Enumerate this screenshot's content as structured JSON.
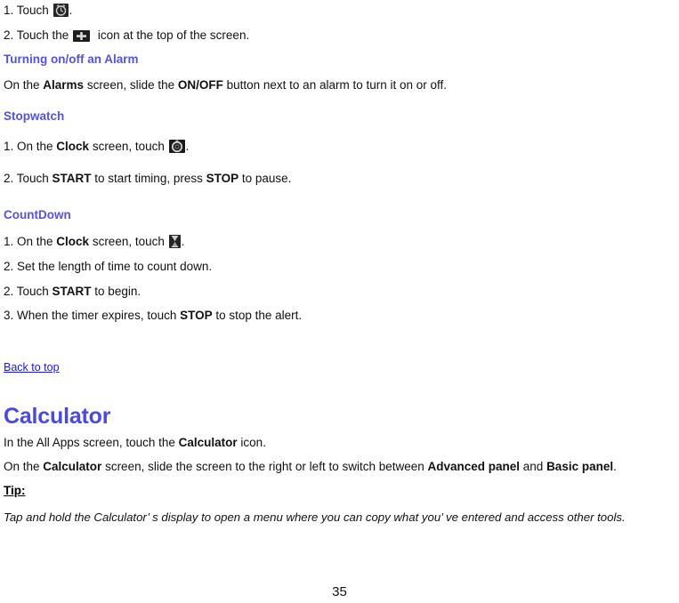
{
  "document": {
    "page_number": "35",
    "colors": {
      "heading_blue": "#5353e0",
      "main_heading_blue": "#4a4ae0",
      "link_blue": "#1a1ae0",
      "body_text": "#111111",
      "background": "#ffffff"
    }
  },
  "clock_section": {
    "step1": {
      "prefix": "1. Touch",
      "icon": "alarm-clock-icon",
      "suffix": "."
    },
    "step2": {
      "prefix": "2. Touch the",
      "icon": "add-plus-icon",
      "suffix": "icon at the top of the screen."
    }
  },
  "alarm_section": {
    "heading": "Turning on/off an Alarm",
    "body": {
      "part1": "On the ",
      "bold1": "Alarms",
      "part2": " screen, slide the ",
      "bold2": "ON/OFF",
      "part3": " button next to an alarm to turn it on or off."
    }
  },
  "stopwatch_section": {
    "heading": "Stopwatch",
    "step1": {
      "part1": "1. On the ",
      "bold1": "Clock",
      "part2": " screen, touch ",
      "icon": "stopwatch-icon",
      "suffix": "."
    },
    "step2": {
      "part1": "2. Touch ",
      "bold1": "START",
      "part2": " to start timing, press ",
      "bold2": "STOP",
      "part3": " to pause."
    }
  },
  "countdown_section": {
    "heading": "CountDown",
    "step1": {
      "part1": "1. On the ",
      "bold1": "Clock",
      "part2": " screen, touch ",
      "icon": "hourglass-icon",
      "suffix": "."
    },
    "step2": "2. Set the length of time to count down.",
    "step3": {
      "part1": "2. Touch ",
      "bold1": "START",
      "part2": " to begin."
    },
    "step4": {
      "part1": "3. When the timer expires, touch ",
      "bold1": "STOP",
      "part2": " to stop the alert."
    }
  },
  "back_to_top": "Back to top",
  "calculator_section": {
    "heading": "Calculator",
    "line1": {
      "part1": "In the All Apps screen, touch the ",
      "bold1": "Calculator",
      "part2": " icon."
    },
    "line2": {
      "part1": "On the ",
      "bold1": "Calculator",
      "part2": " screen, slide the screen to the right or left to switch between ",
      "bold2": "Advanced panel",
      "part3": " and ",
      "bold3": "Basic panel",
      "part4": "."
    },
    "tip_label": "Tip:",
    "tip_body": "Tap and hold the Calculator’ s display to open a menu where you can copy what you’ ve entered and access other tools."
  }
}
